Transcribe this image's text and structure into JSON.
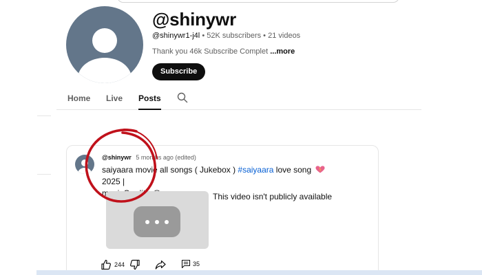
{
  "channel": {
    "name": "@shinywr",
    "handle": "@shinywr1-j4l",
    "separator": "•",
    "subscribers": "52K subscribers",
    "videos": "21 videos",
    "description": "Thank you 46k Subscribe Complet",
    "more_label": "...more",
    "subscribe_label": "Subscribe"
  },
  "tabs": [
    {
      "label": "Home",
      "active": false
    },
    {
      "label": "Live",
      "active": false
    },
    {
      "label": "Posts",
      "active": true
    }
  ],
  "icons": {
    "search": "search-icon",
    "like": "thumbs-up-icon",
    "dislike": "thumbs-down-icon",
    "share": "share-icon",
    "comments": "comment-icon",
    "heart": "heart-emoji-icon",
    "menu": "more-horizontal-icon"
  },
  "post": {
    "author": "@shinywr",
    "time": "5 months ago (edited)",
    "text_before_hashtag": "saiyaara movie all songs ( Jukebox ) ",
    "hashtag": "#saiyaara",
    "text_after_hashtag": " love song",
    "text_after_emoji": " 2025 |",
    "text_line2": "musicCredit : @yr",
    "video_unavailable": "This video isn't publicly available",
    "likes": "244",
    "comments": "35"
  },
  "colors": {
    "avatar": "#63768a",
    "hashtag": "#065fd4",
    "annotation_circle": "#c0111b",
    "subscribe_bg": "#0f0f0f"
  }
}
